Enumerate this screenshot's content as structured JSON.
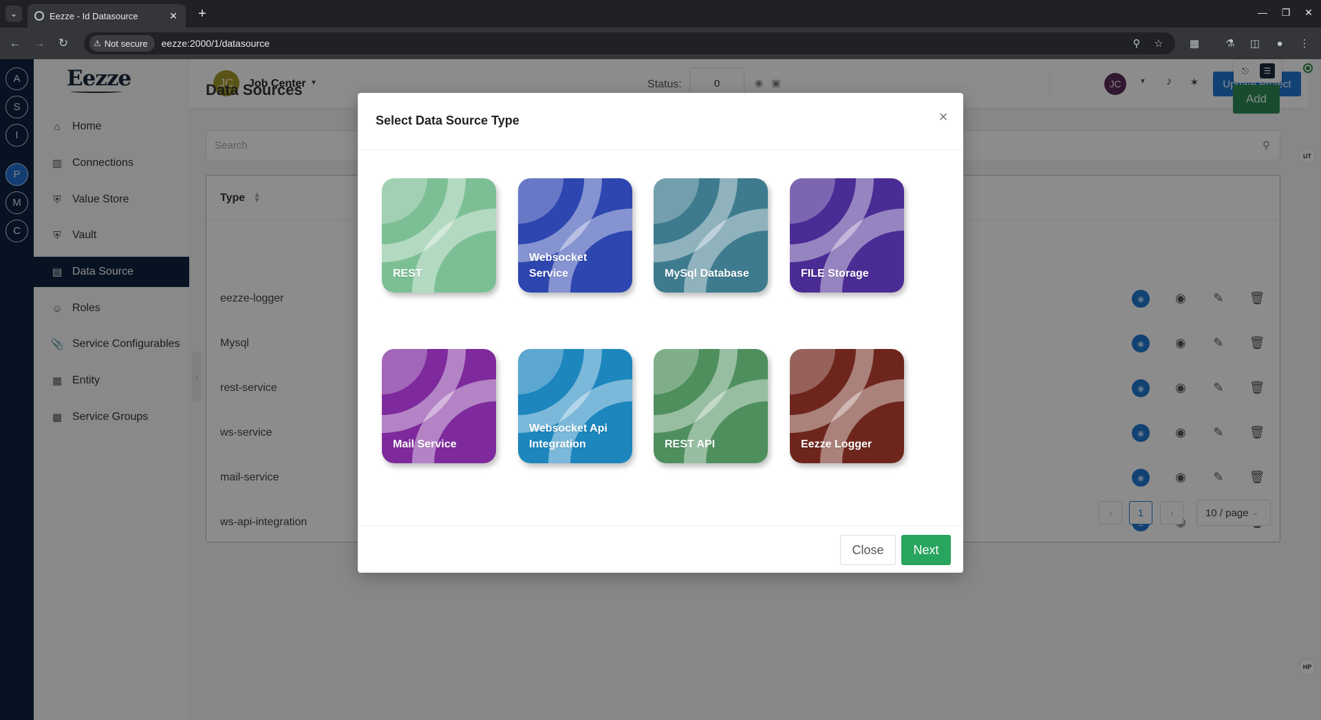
{
  "browser": {
    "tab_title": "Eezze - Id Datasource",
    "security_label": "Not secure",
    "url": "eezze:2000/1/datasource"
  },
  "rail": {
    "items": [
      {
        "letter": "A"
      },
      {
        "letter": "S"
      },
      {
        "letter": "I"
      },
      {
        "letter": "P",
        "active": true
      },
      {
        "letter": "M"
      },
      {
        "letter": "C"
      }
    ]
  },
  "sidebar": {
    "logo": "Eezze",
    "items": [
      {
        "label": "Home",
        "icon": "home-icon"
      },
      {
        "label": "Connections",
        "icon": "bar-chart-icon"
      },
      {
        "label": "Value Store",
        "icon": "shield-icon"
      },
      {
        "label": "Vault",
        "icon": "shield-icon"
      },
      {
        "label": "Data Source",
        "icon": "database-icon",
        "active": true
      },
      {
        "label": "Roles",
        "icon": "users-icon"
      },
      {
        "label": "Service Configurables",
        "icon": "paperclip-icon"
      },
      {
        "label": "Entity",
        "icon": "table-icon"
      },
      {
        "label": "Service Groups",
        "icon": "grid-icon"
      }
    ]
  },
  "header": {
    "project_initials": "JC",
    "project_name": "Job Center",
    "status_label": "Status:",
    "status_value": "0",
    "user_initials": "JC",
    "update_label": "Update Project"
  },
  "page": {
    "title": "Data Sources",
    "add_label": "Add",
    "search_placeholder": "Search",
    "right_badges": [
      "UT",
      "HP"
    ]
  },
  "table": {
    "columns": [
      "Type"
    ],
    "rows": [
      {
        "type": "eezze-logger"
      },
      {
        "type": "Mysql"
      },
      {
        "type": "rest-service"
      },
      {
        "type": "ws-service"
      },
      {
        "type": "mail-service"
      },
      {
        "type": "ws-api-integration"
      }
    ],
    "pagination": {
      "current_page": "1",
      "page_size": "10 / page"
    }
  },
  "modal": {
    "title": "Select Data Source Type",
    "cards": [
      {
        "label": "REST",
        "color": "#7dbf95"
      },
      {
        "label": "Websocket Service",
        "color": "#2d46b0"
      },
      {
        "label": "MySql Database",
        "color": "#3e7b8e"
      },
      {
        "label": "FILE Storage",
        "color": "#4b2b94"
      },
      {
        "label": "Mail Service",
        "color": "#7e2a9c"
      },
      {
        "label": "Websocket Api Integration",
        "color": "#1c86bd"
      },
      {
        "label": "REST API",
        "color": "#4f8f5e"
      },
      {
        "label": "Eezze Logger",
        "color": "#6e261c"
      }
    ],
    "close_label": "Close",
    "next_label": "Next"
  }
}
